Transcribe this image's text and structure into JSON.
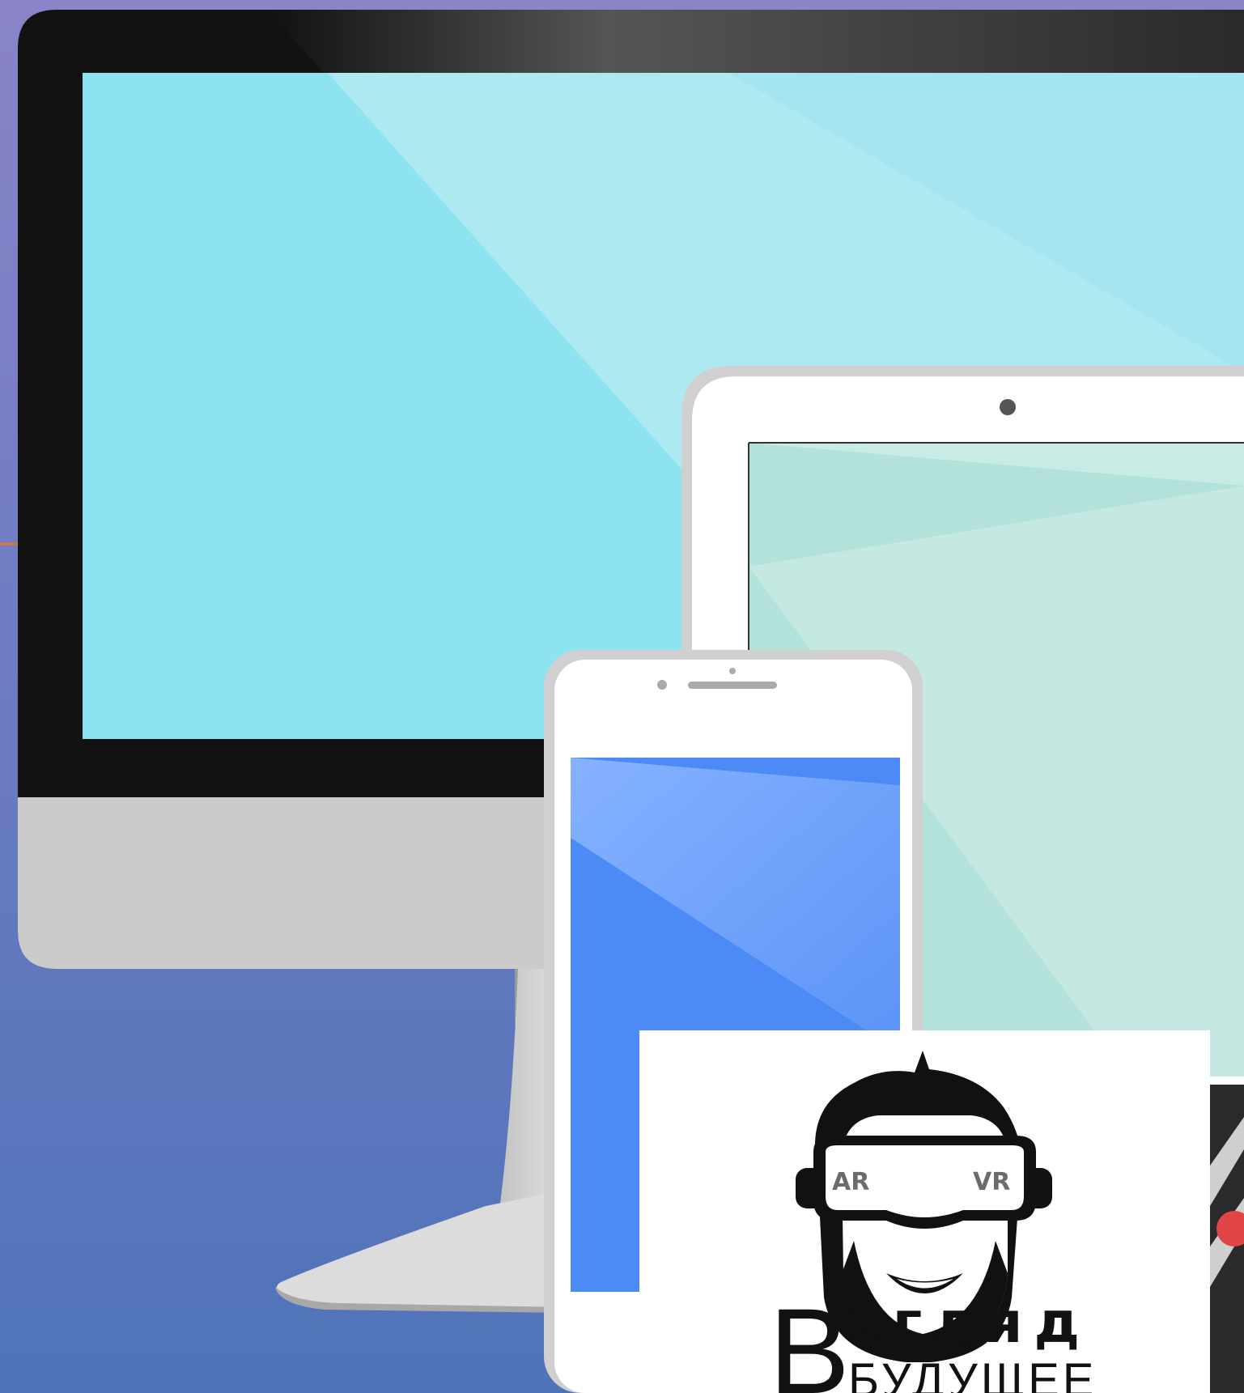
{
  "logo": {
    "goggle_left": "AR",
    "goggle_right": "VR",
    "wordmark_initial": "В",
    "wordmark_top": "згляд",
    "wordmark_bottom": "БУДУЩЕЕ"
  },
  "colors": {
    "background_top": "#8a84c8",
    "background_bottom": "#4f73b9",
    "monitor_screen": "#8ee3f0",
    "monitor_bezel": "#121212",
    "monitor_chin": "#cbcbcb",
    "tablet_screen": "#b2e2da",
    "phone_screen": "#4c8af5",
    "logo_background": "#ffffff",
    "logo_ink": "#111111"
  },
  "icons": [
    "vr-headset-face-icon",
    "tablet-camera-icon",
    "phone-speaker-icon"
  ]
}
